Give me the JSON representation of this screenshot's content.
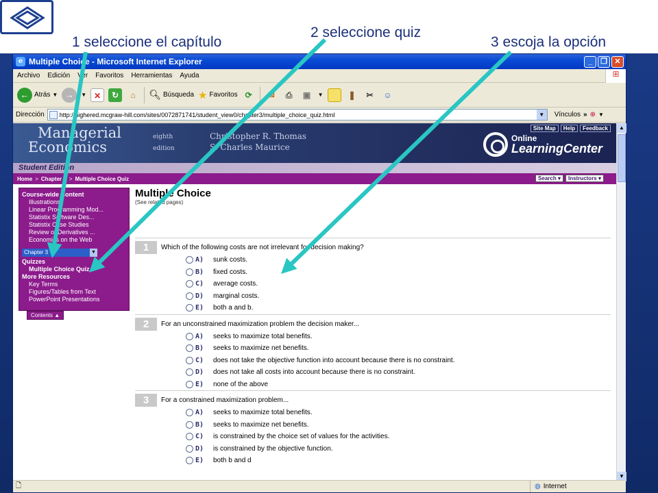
{
  "slide": {
    "callouts": [
      "1 seleccione el capítulo",
      "2 seleccione quiz",
      "3 escoja la opción"
    ],
    "arrow_color": "#29c6c3"
  },
  "window": {
    "title": "Multiple Choice - Microsoft Internet Explorer",
    "menu": [
      "Archivo",
      "Edición",
      "Ver",
      "Favoritos",
      "Herramientas",
      "Ayuda"
    ],
    "toolbar": {
      "back": "Atrás",
      "search": "Búsqueda",
      "favorites": "Favoritos"
    },
    "address_label": "Dirección",
    "url": "http://highered.mcgraw-hill.com/sites/0072871741/student_view0/chapter3/multiple_choice_quiz.html",
    "links_label": "Vínculos",
    "status_zone": "Internet"
  },
  "page": {
    "book_title_1": "Managerial",
    "book_title_2": "Economics",
    "edition_1": "eighth",
    "edition_2": "edition",
    "author_1": "Christopher R. Thomas",
    "author_2": "S. Charles Maurice",
    "header_links": [
      "Site Map",
      "Help",
      "Feedback"
    ],
    "olc_1": "Online",
    "olc_2": "LearningCenter",
    "student_edition": "Student Edition",
    "breadcrumb": [
      "Home",
      "Chapter 3",
      "Multiple Choice Quiz"
    ],
    "crumb_buttons": [
      "Search ▾",
      "Instructors ▾"
    ],
    "sidebar": {
      "course_wide": "Course-wide Content",
      "course_items": [
        "Illustrations",
        "Linear Programming Mod...",
        "Statistix Software Des...",
        "Statistix Case Studies",
        "Review of Derivatives ...",
        "Economics on the Web"
      ],
      "chapter_select": "Chapter 3",
      "quizzes": "Quizzes",
      "quiz_current": "Multiple Choice Quiz",
      "more_resources": "More Resources",
      "more_items": [
        "Key Terms",
        "Figures/Tables from Text",
        "PowerPoint Presentations"
      ],
      "contents_tab": "Contents ▲"
    },
    "quiz": {
      "title": "Multiple Choice",
      "subtitle": "(See related pages)",
      "questions": [
        {
          "num": "1",
          "text": "Which of the following costs are not irrelevant for decision making?",
          "choices": [
            {
              "letter": "A)",
              "text": "sunk costs."
            },
            {
              "letter": "B)",
              "text": "fixed costs."
            },
            {
              "letter": "C)",
              "text": "average costs."
            },
            {
              "letter": "D)",
              "text": "marginal costs."
            },
            {
              "letter": "E)",
              "text": "both a and b."
            }
          ]
        },
        {
          "num": "2",
          "text": "For an unconstrained maximization problem the decision maker...",
          "choices": [
            {
              "letter": "A)",
              "text": "seeks to maximize total benefits."
            },
            {
              "letter": "B)",
              "text": "seeks to maximize net benefits."
            },
            {
              "letter": "C)",
              "text": "does not take the objective function into account because there is no constraint."
            },
            {
              "letter": "D)",
              "text": "does not take all costs into account because there is no constraint."
            },
            {
              "letter": "E)",
              "text": "none of the above"
            }
          ]
        },
        {
          "num": "3",
          "text": "For a constrained maximization problem...",
          "choices": [
            {
              "letter": "A)",
              "text": "seeks to maximize total benefits."
            },
            {
              "letter": "B)",
              "text": "seeks to maximize net benefits."
            },
            {
              "letter": "C)",
              "text": "is constrained by the choice set of values for the activities."
            },
            {
              "letter": "D)",
              "text": "is constrained by the objective function."
            },
            {
              "letter": "E)",
              "text": "both b and d"
            }
          ]
        }
      ]
    }
  }
}
